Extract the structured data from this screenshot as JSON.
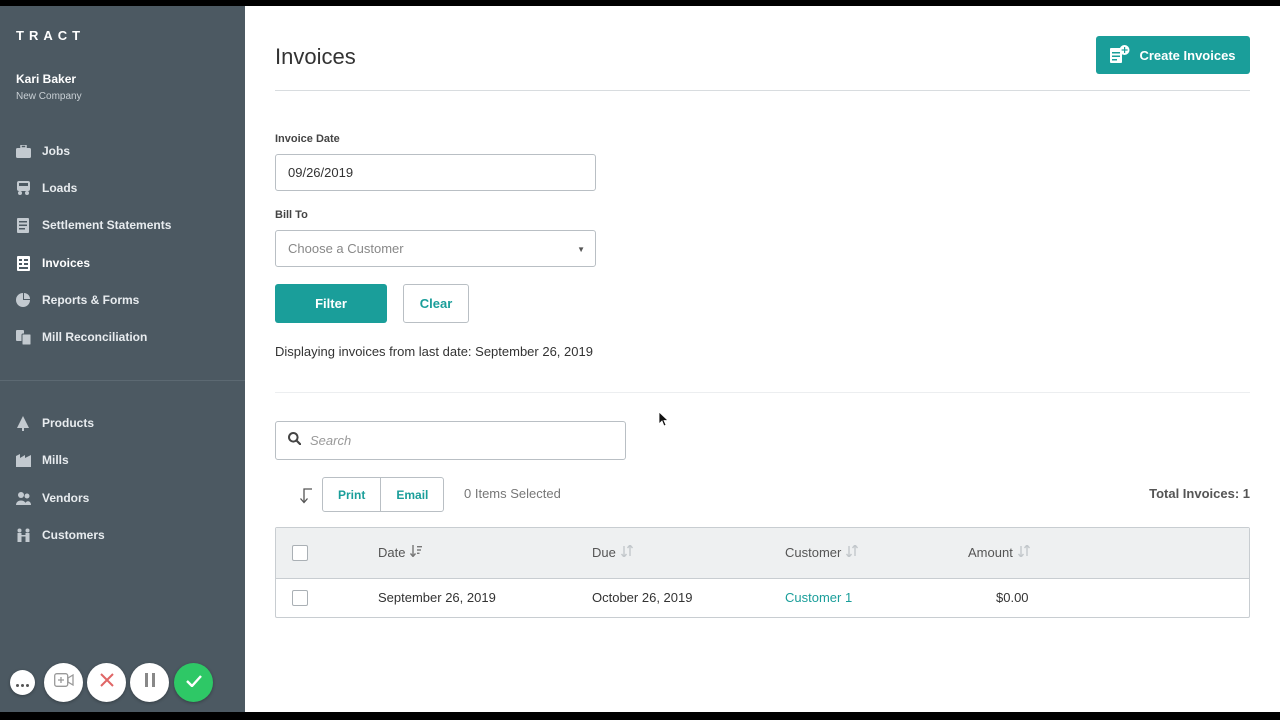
{
  "app": {
    "logo": "TRACT"
  },
  "user": {
    "name": "Kari Baker",
    "company": "New Company"
  },
  "sidebar": {
    "items": [
      {
        "label": "Jobs",
        "icon": "briefcase-icon"
      },
      {
        "label": "Loads",
        "icon": "truck-icon"
      },
      {
        "label": "Settlement Statements",
        "icon": "document-icon"
      },
      {
        "label": "Invoices",
        "icon": "invoice-icon",
        "active": true
      },
      {
        "label": "Reports & Forms",
        "icon": "pie-chart-icon"
      },
      {
        "label": "Mill Reconciliation",
        "icon": "reconcile-icon"
      },
      {
        "label": "Products",
        "icon": "tree-icon"
      },
      {
        "label": "Mills",
        "icon": "factory-icon"
      },
      {
        "label": "Vendors",
        "icon": "users-icon"
      },
      {
        "label": "Customers",
        "icon": "people-icon"
      }
    ]
  },
  "header": {
    "title": "Invoices",
    "create_label": "Create Invoices"
  },
  "filters": {
    "invoice_date_label": "Invoice Date",
    "invoice_date_value": "09/26/2019",
    "bill_to_label": "Bill To",
    "bill_to_placeholder": "Choose a Customer",
    "filter_label": "Filter",
    "clear_label": "Clear",
    "status": "Displaying invoices from last date: September 26, 2019"
  },
  "search": {
    "placeholder": "Search"
  },
  "actions": {
    "print_label": "Print",
    "email_label": "Email",
    "items_selected": "0 Items Selected",
    "total": "Total Invoices: 1"
  },
  "table": {
    "columns": [
      "Date",
      "Due",
      "Customer",
      "Amount"
    ],
    "rows": [
      {
        "date": "September 26, 2019",
        "due": "October 26, 2019",
        "customer": "Customer 1",
        "amount": "$0.00"
      }
    ]
  },
  "colors": {
    "accent": "#1a9e9a",
    "sidebar": "#4c5962",
    "record": "#2ec866",
    "stop": "#e06666"
  }
}
